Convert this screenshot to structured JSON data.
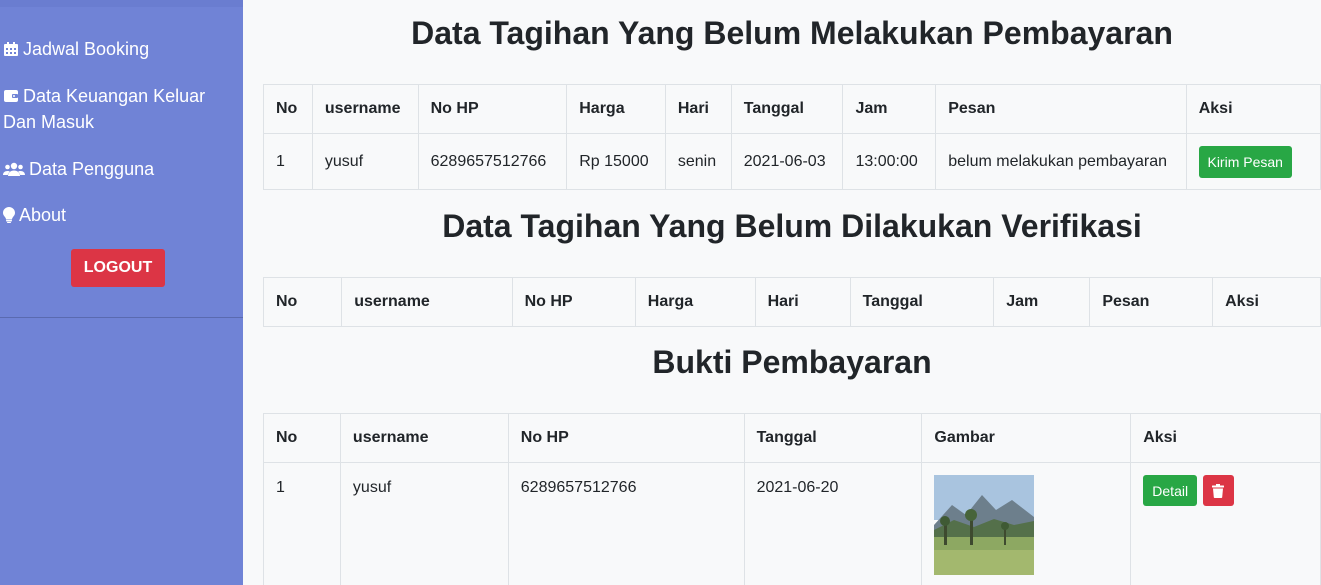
{
  "sidebar": {
    "items": [
      {
        "label": "Jadwal Booking",
        "icon": "calendar-icon"
      },
      {
        "label": "Data Keuangan Keluar Dan Masuk",
        "icon": "wallet-icon"
      },
      {
        "label": "Data Pengguna",
        "icon": "users-icon"
      },
      {
        "label": "About",
        "icon": "lightbulb-icon"
      }
    ],
    "logout_label": "LOGOUT"
  },
  "section1": {
    "title": "Data Tagihan Yang Belum Melakukan Pembayaran",
    "headers": [
      "No",
      "username",
      "No HP",
      "Harga",
      "Hari",
      "Tanggal",
      "Jam",
      "Pesan",
      "Aksi"
    ],
    "rows": [
      {
        "no": "1",
        "username": "yusuf",
        "no_hp": "6289657512766",
        "harga": "Rp 15000",
        "hari": "senin",
        "tanggal": "2021-06-03",
        "jam": "13:00:00",
        "pesan": "belum melakukan pembayaran",
        "action_label": "Kirim Pesan"
      }
    ]
  },
  "section2": {
    "title": "Data Tagihan Yang Belum Dilakukan Verifikasi",
    "headers": [
      "No",
      "username",
      "No HP",
      "Harga",
      "Hari",
      "Tanggal",
      "Jam",
      "Pesan",
      "Aksi"
    ]
  },
  "section3": {
    "title": "Bukti Pembayaran",
    "headers": [
      "No",
      "username",
      "No HP",
      "Tanggal",
      "Gambar",
      "Aksi"
    ],
    "rows": [
      {
        "no": "1",
        "username": "yusuf",
        "no_hp": "6289657512766",
        "tanggal": "2021-06-20",
        "detail_label": "Detail"
      }
    ]
  },
  "colors": {
    "sidebar": "#7083d6",
    "danger": "#dc3545",
    "success": "#28a745"
  }
}
